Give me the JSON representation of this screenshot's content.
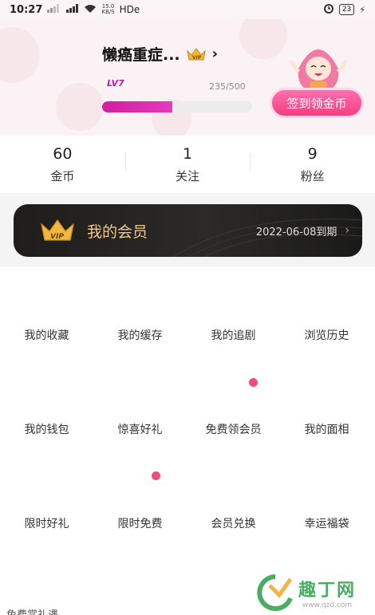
{
  "status_bar": {
    "time": "10:27",
    "network_speed_value": "15.0",
    "network_speed_unit": "KB/S",
    "hd_label": "HDe",
    "battery": "23"
  },
  "profile": {
    "username": "懒癌重症...",
    "level_label": "LV7",
    "level_progress_text": "235/500",
    "level_progress_fraction": 0.47,
    "checkin_label": "签到领金币"
  },
  "stats": [
    {
      "value": "60",
      "label": "金币"
    },
    {
      "value": "1",
      "label": "关注"
    },
    {
      "value": "9",
      "label": "粉丝"
    }
  ],
  "vip": {
    "title": "我的会员",
    "expiry": "2022-06-08到期"
  },
  "grid": [
    {
      "label": "我的收藏"
    },
    {
      "label": "我的缓存"
    },
    {
      "label": "我的追剧"
    },
    {
      "label": "浏览历史"
    },
    {
      "label": "我的钱包"
    },
    {
      "label": "惊喜好礼"
    },
    {
      "label": "免费领会员"
    },
    {
      "label": "我的面相"
    },
    {
      "label": "限时好礼"
    },
    {
      "label": "限时免费"
    },
    {
      "label": "会员兑换"
    },
    {
      "label": "幸运福袋"
    }
  ],
  "bottom_text": "免费赏礼遇",
  "watermark": {
    "text": "趣丁网",
    "url": "www.qzd.com"
  },
  "colors": {
    "accent_pink": "#f0407f",
    "level_purple": "#b81bb0",
    "vip_gold": "#f2c98a",
    "badge_dot": "#ec4f7a"
  }
}
